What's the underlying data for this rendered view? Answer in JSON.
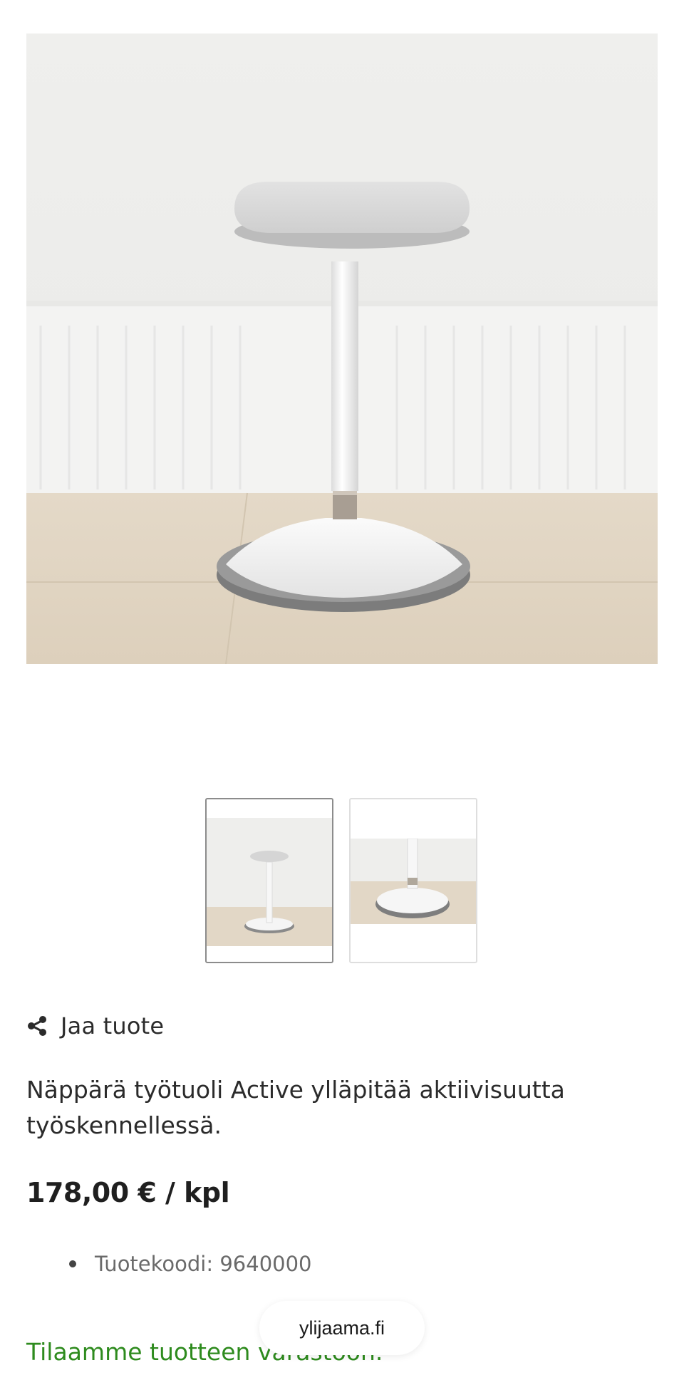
{
  "product": {
    "image_alt": "Työtuoli Active",
    "share_label": "Jaa tuote",
    "description": "Näppärä työtuoli Active ylläpitää aktiivisuutta työskennellessä.",
    "price": "178,00 € / kpl",
    "attributes": [
      {
        "text": "Tuotekoodi: 9640000"
      }
    ],
    "stock_status": "Tilaamme tuotteen varastoon."
  },
  "gallery": {
    "active_index": 0,
    "thumbnails": [
      {
        "label": "full-stool-view"
      },
      {
        "label": "base-closeup-view"
      }
    ]
  },
  "site": {
    "domain": "ylijaama.fi"
  },
  "colors": {
    "stock_green": "#2e8b1e",
    "text": "#2b2b2b",
    "muted": "#6a6a6a"
  },
  "icons": {
    "share": "share-icon"
  }
}
